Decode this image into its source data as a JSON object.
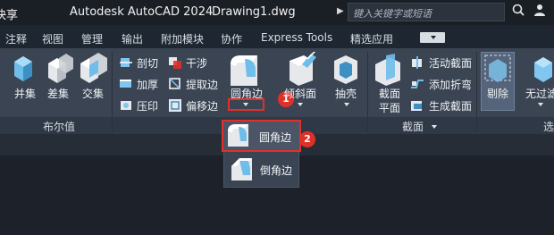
{
  "titlebar": {
    "share": "快享",
    "app_title": "Autodesk AutoCAD 2024",
    "document": "Drawing1.dwg",
    "search_placeholder": "键入关键字或短语"
  },
  "tabs": [
    "注释",
    "视图",
    "管理",
    "输出",
    "附加模块",
    "协作",
    "Express Tools",
    "精选应用"
  ],
  "ribbon": {
    "boolean": {
      "union": "并集",
      "subtract": "差集",
      "intersect": "交集",
      "panel_title": "布尔值"
    },
    "solid_edit": {
      "slice": "剖切",
      "interfere": "干涉",
      "thicken": "加厚",
      "extract_edges": "提取边",
      "imprint": "压印",
      "offset_edges": "偏移边",
      "fillet_edge": "圆角边",
      "taper_faces": "倾斜面",
      "shell": "抽壳"
    },
    "section": {
      "section_plane": "截面平面",
      "section_plane_line1": "截面",
      "section_plane_line2": "平面",
      "live_section": "活动截面",
      "add_jog": "添加折弯",
      "generate_section": "生成截面",
      "panel_title": "截面"
    },
    "culling": "剔除",
    "no_filter": "无过滤",
    "select_truncated": "选"
  },
  "dropdown": {
    "fillet_edge": "圆角边",
    "chamfer_edge": "倒角边"
  },
  "annotations": {
    "step1": "1",
    "step2": "2"
  },
  "colors": {
    "ribbon_bg": "#3a4453",
    "highlight_red": "#e0302a",
    "icon_blue": "#7fc6f0"
  }
}
